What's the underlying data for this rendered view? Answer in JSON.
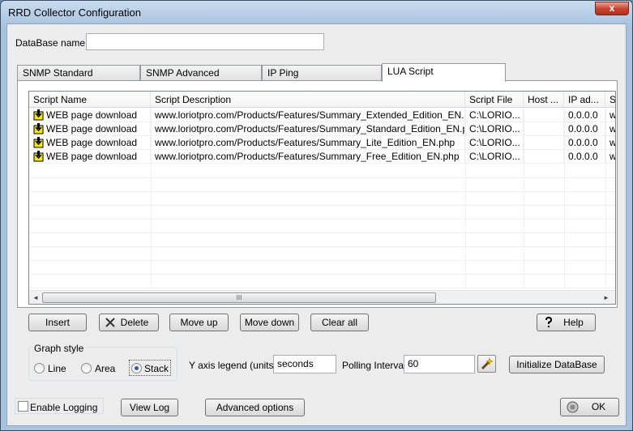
{
  "window": {
    "title": "RRD Collector Configuration",
    "close_glyph": "x"
  },
  "database": {
    "label": "DataBase name",
    "value": ""
  },
  "tabs": [
    {
      "label": "SNMP Standard"
    },
    {
      "label": "SNMP Advanced"
    },
    {
      "label": "IP Ping"
    },
    {
      "label": "LUA Script"
    }
  ],
  "table": {
    "columns": [
      "Script Name",
      "Script Description",
      "Script File",
      "Host ...",
      "IP ad...",
      "S"
    ],
    "rows": [
      {
        "name": "WEB page download",
        "description": "www.loriotpro.com/Products/Features/Summary_Extended_Edition_EN.php",
        "file": "C:\\LORIO...",
        "host": "",
        "ip": "0.0.0.0",
        "s": "w"
      },
      {
        "name": "WEB page download",
        "description": "www.loriotpro.com/Products/Features/Summary_Standard_Edition_EN.php",
        "file": "C:\\LORIO...",
        "host": "",
        "ip": "0.0.0.0",
        "s": "w"
      },
      {
        "name": "WEB page download",
        "description": "www.loriotpro.com/Products/Features/Summary_Lite_Edition_EN.php",
        "file": "C:\\LORIO...",
        "host": "",
        "ip": "0.0.0.0",
        "s": "w"
      },
      {
        "name": "WEB page download",
        "description": "www.loriotpro.com/Products/Features/Summary_Free_Edition_EN.php",
        "file": "C:\\LORIO...",
        "host": "",
        "ip": "0.0.0.0",
        "s": "w"
      }
    ],
    "scroll_grip": "III",
    "scroll_left": "◄",
    "scroll_right": "►"
  },
  "buttons": {
    "insert": "Insert",
    "delete": "Delete",
    "move_up": "Move up",
    "move_down": "Move down",
    "clear_all": "Clear all",
    "help": "Help",
    "initialize": "Initialize DataBase",
    "view_log": "View Log",
    "advanced": "Advanced options",
    "ok": "OK"
  },
  "graph_style": {
    "title": "Graph style",
    "options": [
      "Line",
      "Area",
      "Stack"
    ],
    "selected": "Stack"
  },
  "y_axis": {
    "label": "Y axis legend (units)",
    "value": "seconds"
  },
  "polling": {
    "label": "Polling Interval",
    "value": "60"
  },
  "logging": {
    "label": "Enable Logging",
    "checked": false
  },
  "icons": {
    "delete": "x-icon",
    "help": "question-icon",
    "wand": "magic-wand-icon",
    "ok": "ok-icon",
    "script": "script-icon"
  },
  "colors": {
    "title_bar": "#b9d1ea",
    "close_button": "#c9452e",
    "client": "#ececec"
  }
}
